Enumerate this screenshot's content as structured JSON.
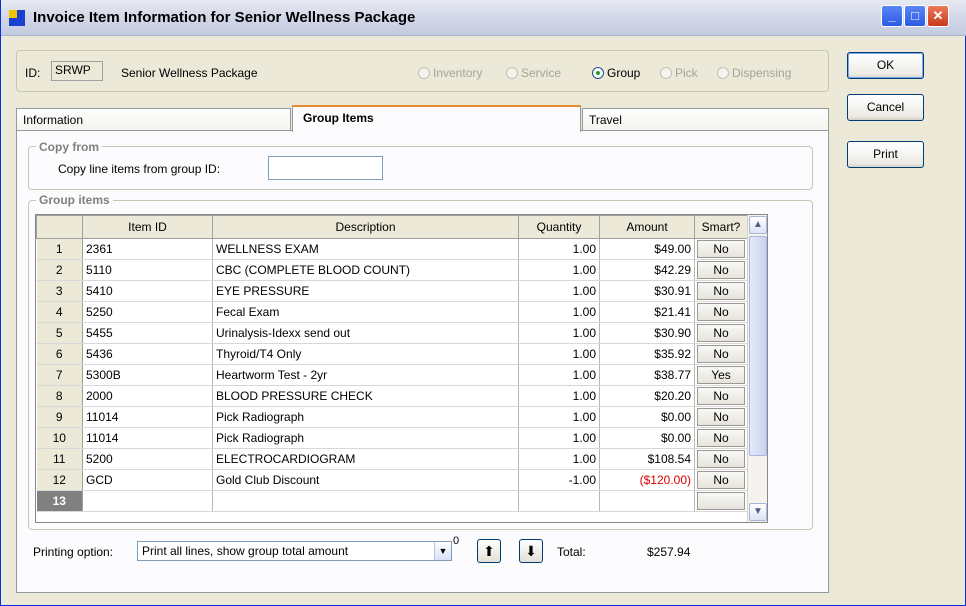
{
  "window": {
    "title": "Invoice Item Information for Senior Wellness Package"
  },
  "header": {
    "id_label": "ID:",
    "id_value": "SRWP",
    "name": "Senior Wellness Package",
    "types": [
      {
        "label": "Inventory",
        "selected": false
      },
      {
        "label": "Service",
        "selected": false
      },
      {
        "label": "Group",
        "selected": true
      },
      {
        "label": "Pick",
        "selected": false
      },
      {
        "label": "Dispensing",
        "selected": false
      }
    ]
  },
  "buttons": {
    "ok": "OK",
    "cancel": "Cancel",
    "print": "Print"
  },
  "tabs": [
    {
      "label": "Information"
    },
    {
      "label": "Group Items"
    },
    {
      "label": "Travel"
    }
  ],
  "copy_from": {
    "title": "Copy from",
    "label": "Copy line items from group ID:",
    "value": ""
  },
  "group_items": {
    "title": "Group  items",
    "columns": [
      "Item ID",
      "Description",
      "Quantity",
      "Amount",
      "Smart?"
    ],
    "rows": [
      {
        "n": "1",
        "id": "2361",
        "desc": "WELLNESS EXAM",
        "qty": "1.00",
        "amt": "$49.00",
        "smart": "No"
      },
      {
        "n": "2",
        "id": "5110",
        "desc": "CBC (COMPLETE BLOOD COUNT)",
        "qty": "1.00",
        "amt": "$42.29",
        "smart": "No"
      },
      {
        "n": "3",
        "id": "5410",
        "desc": "EYE PRESSURE",
        "qty": "1.00",
        "amt": "$30.91",
        "smart": "No"
      },
      {
        "n": "4",
        "id": "5250",
        "desc": "Fecal Exam",
        "qty": "1.00",
        "amt": "$21.41",
        "smart": "No"
      },
      {
        "n": "5",
        "id": "5455",
        "desc": "Urinalysis-Idexx send out",
        "qty": "1.00",
        "amt": "$30.90",
        "smart": "No"
      },
      {
        "n": "6",
        "id": "5436",
        "desc": "Thyroid/T4 Only",
        "qty": "1.00",
        "amt": "$35.92",
        "smart": "No"
      },
      {
        "n": "7",
        "id": "5300B",
        "desc": "Heartworm Test  - 2yr",
        "qty": "1.00",
        "amt": "$38.77",
        "smart": "Yes"
      },
      {
        "n": "8",
        "id": "2000",
        "desc": "BLOOD PRESSURE CHECK",
        "qty": "1.00",
        "amt": "$20.20",
        "smart": "No"
      },
      {
        "n": "9",
        "id": "11014",
        "desc": "Pick Radiograph",
        "qty": "1.00",
        "amt": "$0.00",
        "smart": "No"
      },
      {
        "n": "10",
        "id": "11014",
        "desc": "Pick Radiograph",
        "qty": "1.00",
        "amt": "$0.00",
        "smart": "No"
      },
      {
        "n": "11",
        "id": "5200",
        "desc": "ELECTROCARDIOGRAM",
        "qty": "1.00",
        "amt": "$108.54",
        "smart": "No"
      },
      {
        "n": "12",
        "id": "GCD",
        "desc": "Gold Club Discount",
        "qty": "-1.00",
        "amt": "($120.00)",
        "smart": "No",
        "negative": true
      },
      {
        "n": "13",
        "id": "",
        "desc": "",
        "qty": "",
        "amt": "",
        "smart": "",
        "current": true
      }
    ]
  },
  "footer": {
    "printing_label": "Printing option:",
    "printing_value": "Print all lines, show group total amount",
    "superscript": "0",
    "total_label": "Total:",
    "total_value": "$257.94"
  },
  "colors": {
    "negative": "#dd0000",
    "tab_accent": "#e68b2c"
  }
}
